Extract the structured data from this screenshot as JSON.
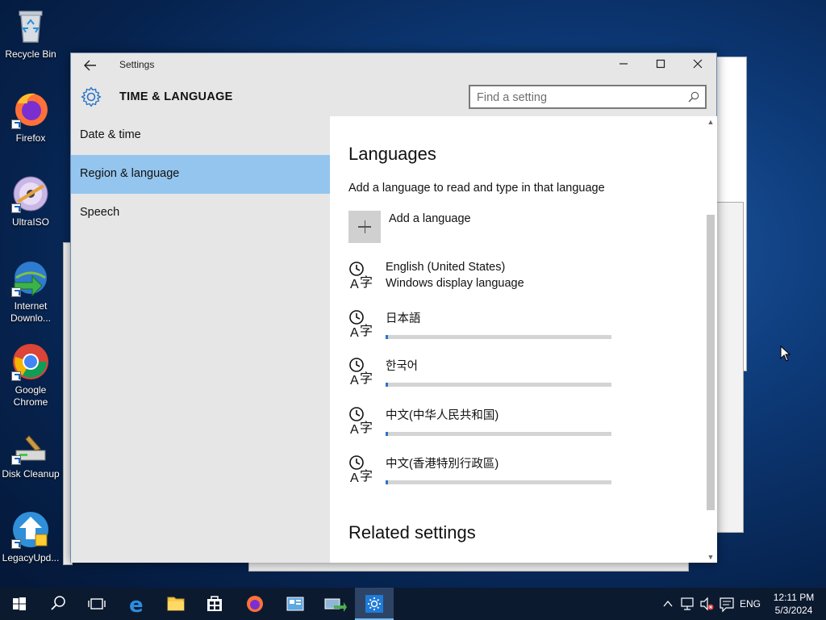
{
  "desktop": {
    "icons": [
      {
        "label": "Recycle Bin"
      },
      {
        "label": "Firefox"
      },
      {
        "label": "UltraISO"
      },
      {
        "label": "Internet Downlo..."
      },
      {
        "label": "Google Chrome"
      },
      {
        "label": "Disk Cleanup"
      },
      {
        "label": "LegacyUpd..."
      }
    ]
  },
  "window": {
    "title": "Settings",
    "header_title": "TIME & LANGUAGE",
    "search": {
      "placeholder": "Find a setting",
      "value": ""
    }
  },
  "sidebar": {
    "items": [
      {
        "label": "Date & time",
        "active": false
      },
      {
        "label": "Region & language",
        "active": true
      },
      {
        "label": "Speech",
        "active": false
      }
    ]
  },
  "content": {
    "languages_title": "Languages",
    "languages_subtitle": "Add a language to read and type in that language",
    "add_language_label": "Add a language",
    "languages": [
      {
        "name": "English (United States)",
        "subtitle": "Windows display language",
        "progress": null
      },
      {
        "name": "日本語",
        "subtitle": null,
        "progress": 0.01
      },
      {
        "name": "한국어",
        "subtitle": null,
        "progress": 0.01
      },
      {
        "name": "中文(中华人民共和国)",
        "subtitle": null,
        "progress": 0.01
      },
      {
        "name": "中文(香港特別行政區)",
        "subtitle": null,
        "progress": 0.01
      }
    ],
    "related_title": "Related settings"
  },
  "taskbar": {
    "language": "ENG",
    "time": "12:11 PM",
    "date": "5/3/2024"
  },
  "colors": {
    "selection": "#94c5ee",
    "progress": "#2a73c8",
    "taskbar": "#0c1a30"
  }
}
